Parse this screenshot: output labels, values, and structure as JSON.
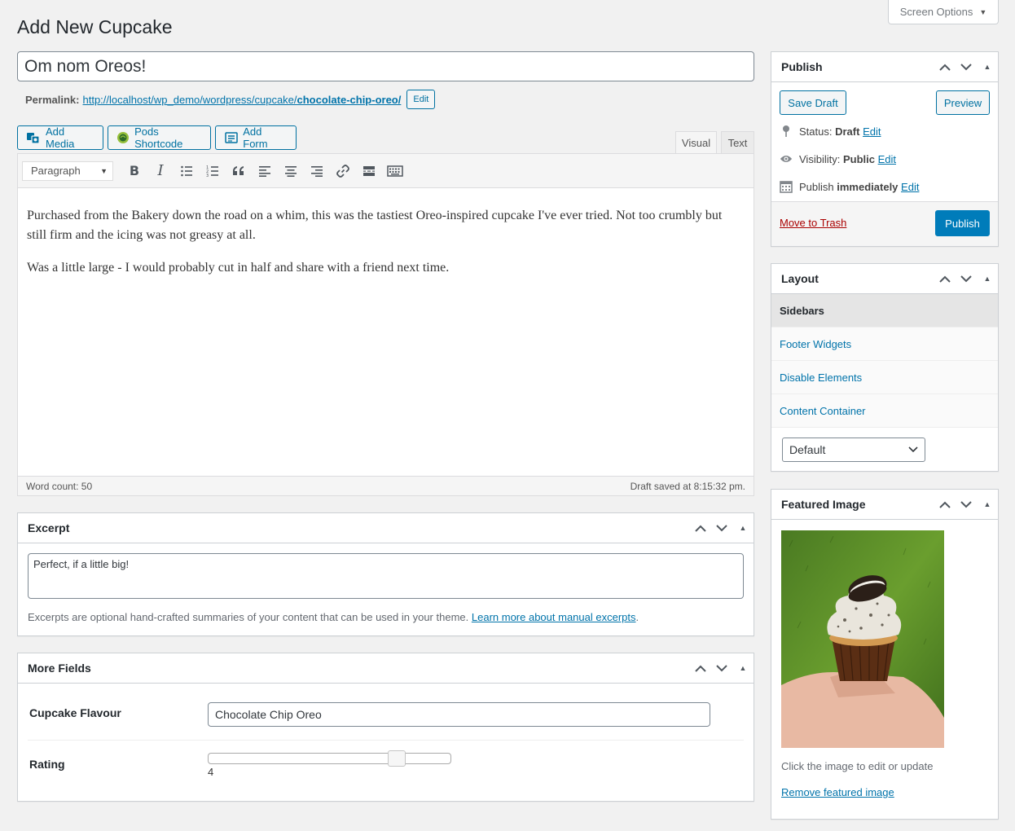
{
  "screen_options": {
    "label": "Screen Options"
  },
  "page": {
    "title": "Add New Cupcake"
  },
  "post": {
    "title": "Om nom Oreos!",
    "permalink_label": "Permalink:",
    "permalink_base": "http://localhost/wp_demo/wordpress/cupcake/",
    "permalink_slug": "chocolate-chip-oreo/",
    "permalink_edit": "Edit"
  },
  "media_buttons": {
    "add_media": "Add Media",
    "pods_shortcode": "Pods Shortcode",
    "add_form": "Add Form"
  },
  "editor_tabs": {
    "visual": "Visual",
    "text": "Text"
  },
  "toolbar": {
    "format_value": "Paragraph",
    "bold": "B",
    "italic": "I"
  },
  "content": {
    "p1": "Purchased from the Bakery down the road on a whim, this was the tastiest Oreo-inspired cupcake I've ever tried. Not too crumbly but still firm and the icing was not greasy at all.",
    "p2": "Was a little large - I would probably cut in half and share with a friend next time."
  },
  "editor_status": {
    "word_count": "Word count: 50",
    "draft_saved": "Draft saved at 8:15:32 pm."
  },
  "excerpt": {
    "title": "Excerpt",
    "value": "Perfect, if a little big!",
    "note": "Excerpts are optional hand-crafted summaries of your content that can be used in your theme.",
    "link": "Learn more about manual excerpts",
    "note_end": "."
  },
  "more_fields": {
    "title": "More Fields",
    "flavour_label": "Cupcake Flavour",
    "flavour_value": "Chocolate Chip Oreo",
    "rating_label": "Rating",
    "rating_value": "4",
    "rating_fraction": 0.8
  },
  "publish": {
    "title": "Publish",
    "save_draft": "Save Draft",
    "preview": "Preview",
    "status_label": "Status:",
    "status_value": "Draft",
    "visibility_label": "Visibility:",
    "visibility_value": "Public",
    "publish_label": "Publish",
    "publish_value": "immediately",
    "edit": "Edit",
    "trash": "Move to Trash",
    "publish_button": "Publish"
  },
  "layout": {
    "title": "Layout",
    "tabs": [
      "Sidebars",
      "Footer Widgets",
      "Disable Elements",
      "Content Container"
    ],
    "select_value": "Default"
  },
  "featured_image": {
    "title": "Featured Image",
    "hint": "Click the image to edit or update",
    "remove": "Remove featured image"
  },
  "colors": {
    "primary": "#007cba",
    "link": "#0073aa",
    "trash": "#a00"
  }
}
